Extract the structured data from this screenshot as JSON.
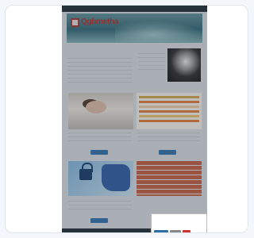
{
  "site": {
    "topbar_text": "",
    "logo": "Qgbmetha",
    "main_heading": "",
    "side_heading": "",
    "cookie": {
      "title": "",
      "body": "",
      "accept": "",
      "settings": "",
      "reject": ""
    }
  },
  "colors": {
    "accent": "#2f6ea8",
    "brand_red": "#a5302d",
    "dark_bar": "#1f2a33"
  }
}
